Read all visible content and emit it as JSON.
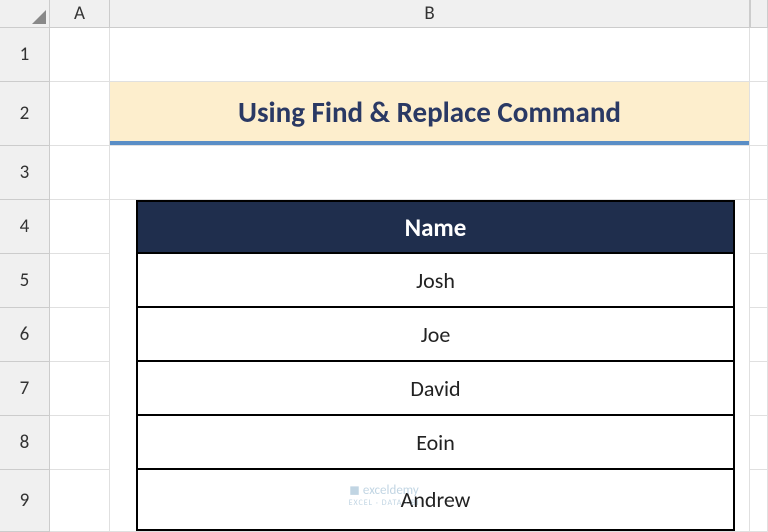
{
  "columns": {
    "A": "A",
    "B": "B"
  },
  "rows": [
    "1",
    "2",
    "3",
    "4",
    "5",
    "6",
    "7",
    "8",
    "9"
  ],
  "title": "Using Find & Replace Command",
  "table": {
    "header": "Name",
    "data": [
      "Josh",
      "Joe",
      "David",
      "Eoin",
      "Andrew"
    ]
  },
  "watermark": {
    "main": "exceldemy",
    "sub": "EXCEL · DATA · BI"
  }
}
